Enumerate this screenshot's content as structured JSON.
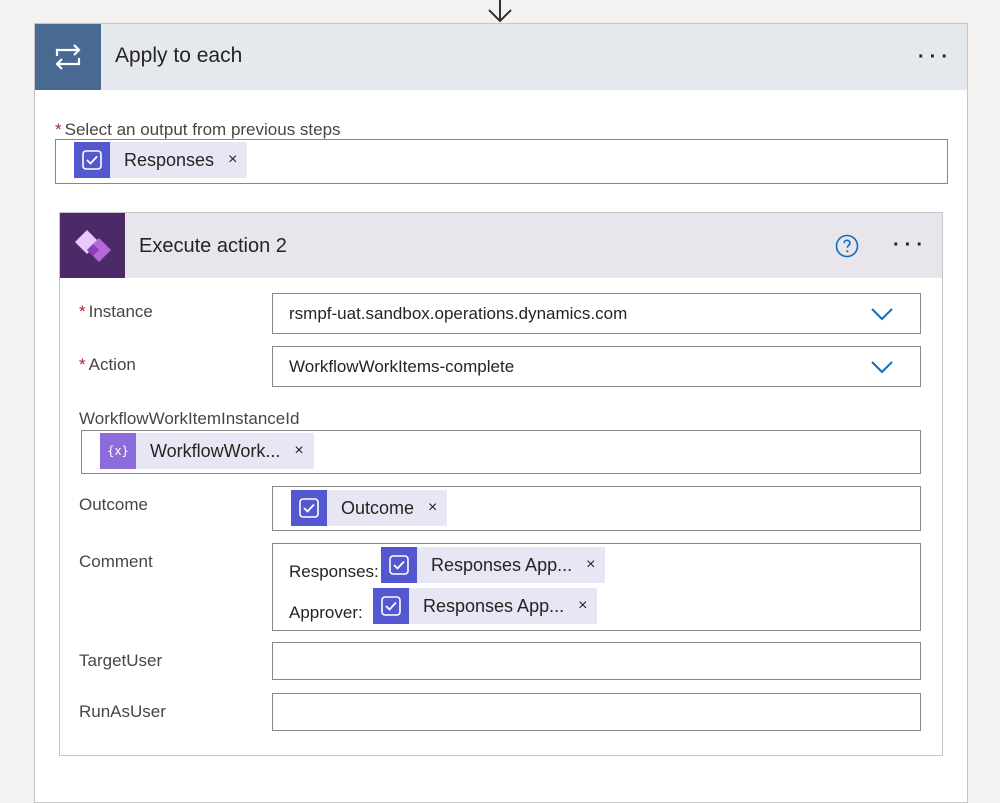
{
  "outer": {
    "title": "Apply to each",
    "more_label": "···",
    "select_label": "Select an output from previous steps",
    "required_mark": "*",
    "token": {
      "label": "Responses",
      "close": "×"
    }
  },
  "inner": {
    "title": "Execute action 2",
    "more_label": "···",
    "fields": {
      "instance": {
        "label": "Instance",
        "value": "rsmpf-uat.sandbox.operations.dynamics.com"
      },
      "action": {
        "label": "Action",
        "value": "WorkflowWorkItems-complete"
      },
      "instance_id": {
        "label": "WorkflowWorkItemInstanceId",
        "token": "WorkflowWork...",
        "close": "×"
      },
      "outcome": {
        "label": "Outcome",
        "token": "Outcome",
        "close": "×"
      },
      "comment": {
        "label": "Comment",
        "line1_prefix": "Responses:",
        "line1_token": "Responses App...",
        "line2_prefix": "Approver:",
        "line2_token": "Responses App...",
        "close": "×"
      },
      "target_user": {
        "label": "TargetUser",
        "value": ""
      },
      "run_as_user": {
        "label": "RunAsUser",
        "value": ""
      }
    }
  },
  "colors": {
    "outer_icon_bg": "#486991",
    "inner_icon_bg": "#4c2a67",
    "token_icon_bg": "#5458d0",
    "variable_token_icon_bg": "#8c6cdb",
    "token_bg": "#e6e6f5",
    "chevron": "#0f6cbd",
    "required_star": "#a4262c"
  },
  "icons": {
    "outer": "loop-icon",
    "inner": "power-apps-icon",
    "token": "approval-icon",
    "variable_token": "variable-icon",
    "help": "help-circle-icon",
    "dropdown": "chevron-down-icon",
    "connector": "arrow-down-icon"
  }
}
